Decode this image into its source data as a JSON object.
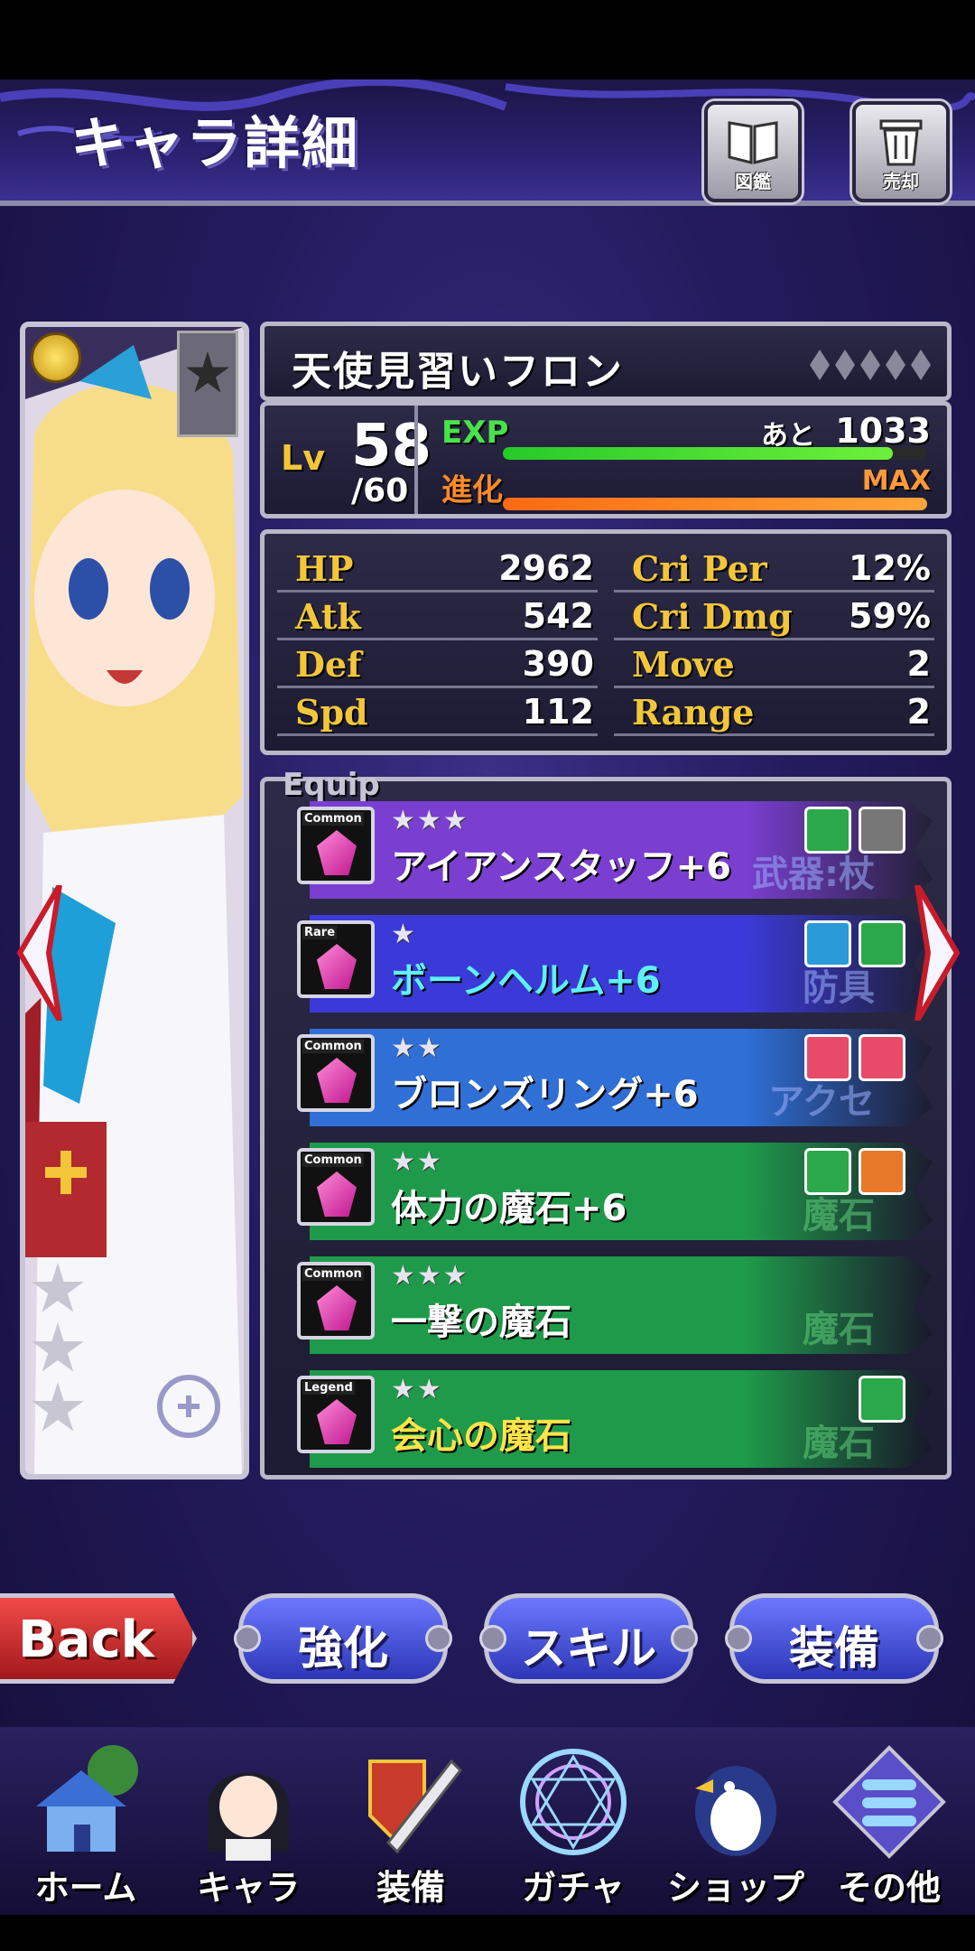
{
  "header": {
    "title": "キャラ詳細",
    "buttons": [
      {
        "label": "図鑑",
        "icon": "book-icon"
      },
      {
        "label": "売却",
        "icon": "trash-icon"
      }
    ]
  },
  "character": {
    "name": "天使見習いフロン",
    "level_label": "Lv",
    "level": "58",
    "level_max": "/60",
    "exp_label": "EXP",
    "exp_rest_label": "あと",
    "exp_rest_value": "1033",
    "exp_progress": 0.92,
    "evolve_label": "進化",
    "evolve_value": "MAX",
    "evolve_progress": 1.0,
    "rarity_diamonds": 5
  },
  "stats": {
    "left": [
      {
        "label": "HP",
        "value": "2962"
      },
      {
        "label": "Atk",
        "value": "542"
      },
      {
        "label": "Def",
        "value": "390"
      },
      {
        "label": "Spd",
        "value": "112"
      }
    ],
    "right": [
      {
        "label": "Cri Per",
        "value": "12%"
      },
      {
        "label": "Cri Dmg",
        "value": "59%"
      },
      {
        "label": "Move",
        "value": "2"
      },
      {
        "label": "Range",
        "value": "2"
      }
    ]
  },
  "equip": {
    "header": "Equip",
    "items": [
      {
        "rarity": "Common",
        "stars": "★★★",
        "name": "アイアンスタッフ+6",
        "category": "武器:杖",
        "name_color": "#ffffff",
        "band": "#7a3ed0",
        "icons": [
          "shield-percent-icon",
          "gear-percent-icon"
        ]
      },
      {
        "rarity": "Rare",
        "stars": "★",
        "name": "ボーンヘルム+6",
        "category": "防具",
        "name_color": "#5ef0ff",
        "band": "#3b3ad8",
        "icons": [
          "boot-icon",
          "shield-icon"
        ]
      },
      {
        "rarity": "Common",
        "stars": "★★",
        "name": "ブロンズリング+6",
        "category": "アクセ",
        "name_color": "#ffffff",
        "band": "#2f6fd6",
        "icons": [
          "heart-icon",
          "heart-percent-icon"
        ]
      },
      {
        "rarity": "Common",
        "stars": "★★",
        "name": "体力の魔石+6",
        "category": "魔石",
        "name_color": "#ffffff",
        "band": "#1f9a4a",
        "icons": [
          "shield-icon",
          "sword-icon"
        ]
      },
      {
        "rarity": "Common",
        "stars": "★★★",
        "name": "一撃の魔石",
        "category": "魔石",
        "name_color": "#ffffff",
        "band": "#1f9a4a",
        "icons": []
      },
      {
        "rarity": "Legend",
        "stars": "★★",
        "name": "会心の魔石",
        "category": "魔石",
        "name_color": "#ffe44a",
        "band": "#1f9a4a",
        "icons": [
          "shield-icon"
        ]
      }
    ]
  },
  "actions": {
    "back": "Back",
    "enhance": "強化",
    "skill": "スキル",
    "equipment": "装備"
  },
  "nav": [
    {
      "label": "ホーム",
      "icon": "house-icon"
    },
    {
      "label": "キャラ",
      "icon": "character-icon"
    },
    {
      "label": "装備",
      "icon": "sword-shield-icon"
    },
    {
      "label": "ガチャ",
      "icon": "magic-circle-icon"
    },
    {
      "label": "ショップ",
      "icon": "penguin-icon"
    },
    {
      "label": "その他",
      "icon": "menu-icon"
    }
  ]
}
